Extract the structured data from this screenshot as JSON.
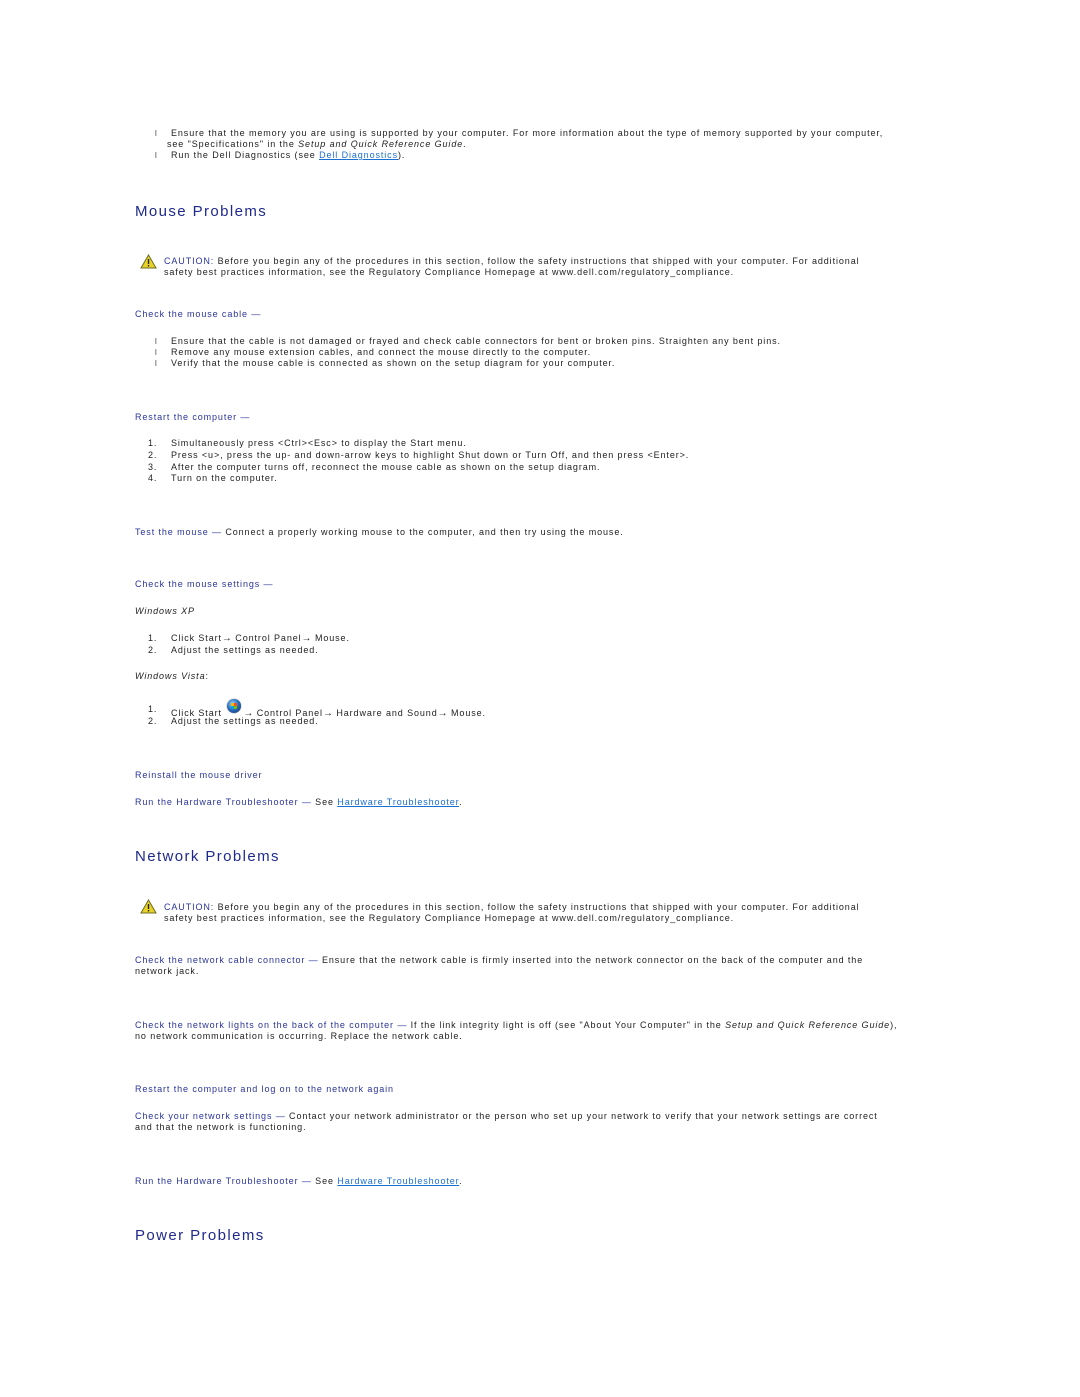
{
  "intro": {
    "bullet_glyph": "l",
    "item1_line1": "Ensure that the memory you are using is supported by your computer. For more information about the type of memory supported by your computer,",
    "item1_line2_pre": "see \"Specifications\" in the ",
    "item1_line2_em": "Setup and Quick Reference Guide",
    "item1_line2_post": ".",
    "item2_pre": "Run the Dell Diagnostics (see ",
    "item2_link": "Dell Diagnostics",
    "item2_post": ")."
  },
  "mouse": {
    "title": "Mouse Problems",
    "caution_label": "CAUTION:",
    "caution_line1": " Before you begin any of the procedures in this section, follow the safety instructions that shipped with your computer. For additional",
    "caution_line2": "safety best practices information, see the Regulatory Compliance Homepage at www.dell.com/regulatory_compliance.",
    "check_cable": {
      "heading": "Check the mouse cable —",
      "items": [
        "Ensure that the cable is not damaged or frayed and check cable connectors for bent or broken pins. Straighten any bent pins.",
        "Remove any mouse extension cables, and connect the mouse directly to the computer.",
        "Verify that the mouse cable is connected as shown on the setup diagram for your computer."
      ]
    },
    "restart": {
      "heading": "Restart the computer —",
      "steps": [
        "Simultaneously press <Ctrl><Esc> to display the Start menu.",
        "Press <u>, press the up- and down-arrow keys to highlight Shut down or Turn Off, and then press <Enter>.",
        "After the computer turns off, reconnect the mouse cable as shown on the setup diagram.",
        "Turn on the computer."
      ]
    },
    "test": {
      "heading": "Test the mouse —",
      "text": " Connect a properly working mouse to the computer, and then try using the mouse."
    },
    "settings": {
      "heading": "Check the mouse settings —",
      "xp_label": "Windows XP",
      "xp_step1_a": "Click Start",
      "xp_step1_b": " Control Panel",
      "xp_step1_c": " Mouse.",
      "xp_step2": "Adjust the settings as needed.",
      "vista_label": "Windows Vista",
      "vista_label_suffix": ":",
      "vista_step1_a": "Click Start ",
      "vista_step1_b": " Control Panel",
      "vista_step1_c": " Hardware and Sound",
      "vista_step1_d": " Mouse.",
      "vista_step2": "Adjust the settings as needed.",
      "arrow": "→"
    },
    "reinstall": "Reinstall the mouse driver",
    "troubleshooter": {
      "heading": "Run the Hardware Troubleshooter —",
      "pre": " See ",
      "link": "Hardware Troubleshooter",
      "post": "."
    }
  },
  "network": {
    "title": "Network Problems",
    "caution_label": "CAUTION:",
    "caution_line1": " Before you begin any of the procedures in this section, follow the safety instructions that shipped with your computer. For additional",
    "caution_line2": "safety best practices information, see the Regulatory Compliance Homepage at www.dell.com/regulatory_compliance.",
    "cable": {
      "heading": "Check the network cable connector —",
      "line1": " Ensure that the network cable is firmly inserted into the network connector on the back of the computer and the",
      "line2": "network jack."
    },
    "lights": {
      "heading": "Check the network lights on the back of the computer —",
      "line1_pre": " If the link integrity light is off (see \"About Your Computer\" in the ",
      "line1_em": "Setup and Quick Reference Guide",
      "line1_post": "),",
      "line2": "no network communication is occurring. Replace the network cable."
    },
    "restart": "Restart the computer and log on to the network again",
    "settings": {
      "heading": "Check your network settings —",
      "line1": " Contact your network administrator or the person who set up your network to verify that your network settings are correct",
      "line2": "and that the network is functioning."
    },
    "troubleshooter": {
      "heading": "Run the Hardware Troubleshooter —",
      "pre": " See ",
      "link": "Hardware Troubleshooter",
      "post": "."
    }
  },
  "power": {
    "title": "Power Problems"
  },
  "colors": {
    "heading": "#1f2a8c",
    "subheading": "#2b3599",
    "link": "#1a6fd0",
    "caution_yellow": "#e8d22a"
  }
}
